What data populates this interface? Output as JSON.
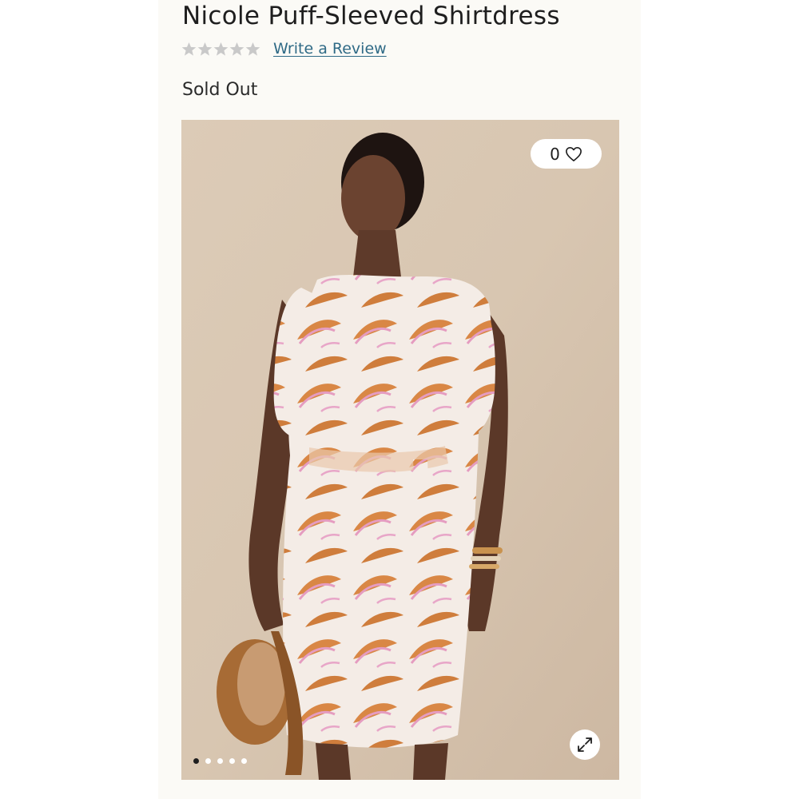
{
  "product": {
    "title": "Nicole Puff-Sleeved Shirtdress",
    "rating": {
      "stars": 0,
      "max": 5,
      "write_review_label": "Write a Review"
    },
    "availability": "Sold Out"
  },
  "gallery": {
    "like_count": "0",
    "slide_count": 5,
    "active_slide": 1
  },
  "colors": {
    "star_empty": "#c9c9c9",
    "link": "#2f6a86",
    "page_background": "#fbfaf6"
  }
}
